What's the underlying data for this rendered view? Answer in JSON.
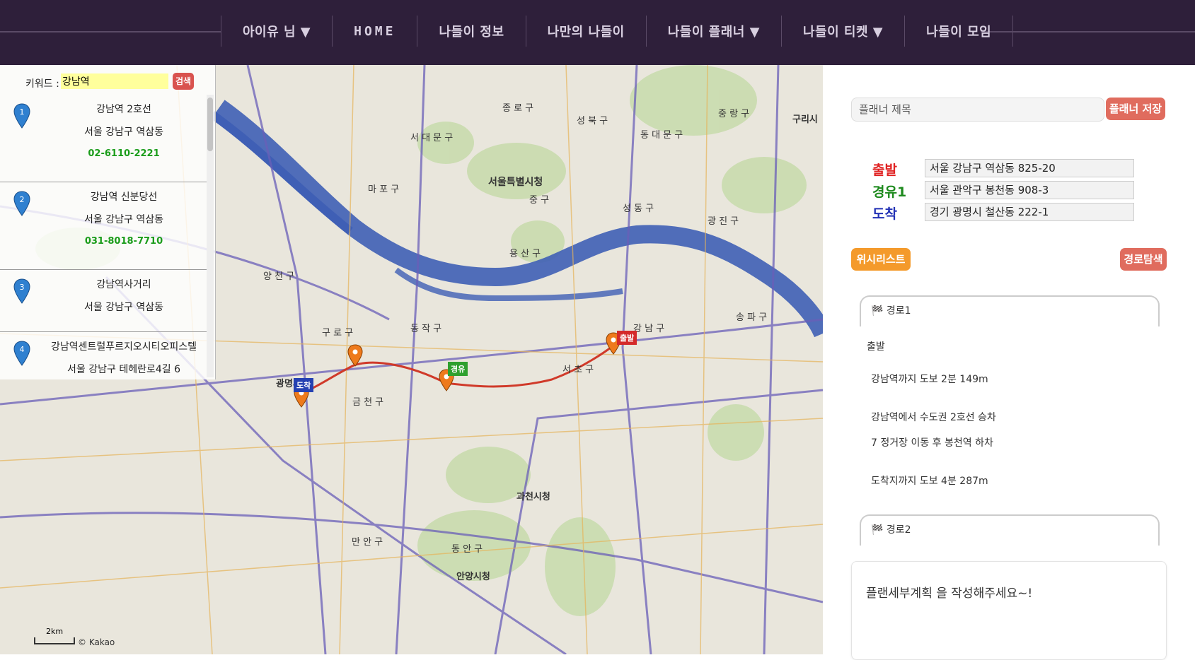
{
  "nav": {
    "user": "아이유 님 ▼",
    "home": "HOME",
    "info": "나들이 정보",
    "mine": "나만의 나들이",
    "planner": "나들이 플래너 ▼",
    "ticket": "나들이 티켓 ▼",
    "meet": "나들이 모임"
  },
  "search": {
    "keyword_label": "키워드 :",
    "keyword_value": "강남역",
    "button": "검색",
    "results": [
      {
        "num": "1",
        "name": "강남역 2호선",
        "address": "서울 강남구 역삼동",
        "phone": "02-6110-2221"
      },
      {
        "num": "2",
        "name": "강남역 신분당선",
        "address": "서울 강남구 역삼동",
        "phone": "031-8018-7710"
      },
      {
        "num": "3",
        "name": "강남역사거리",
        "address": "서울 강남구 역삼동",
        "phone": ""
      },
      {
        "num": "4",
        "name": "강남역센트럴푸르지오시티오피스텔",
        "address": "서울 강남구 테헤란로4길 6",
        "phone": ""
      }
    ]
  },
  "map": {
    "labels": {
      "seoul_hall": "서울특별시청",
      "gwangmyeong": "광명시청",
      "gwacheon": "과천시청",
      "anyang": "안양시청",
      "gangnam": "강 남 구",
      "mapo": "마 포 구",
      "yangcheon": "양 천 구",
      "guro": "구 로 구",
      "dongjak": "동 작 구",
      "geumcheon": "금 천 구",
      "yongsan": "용 산 구",
      "seocho": "서 초 구",
      "songpa": "송 파 구",
      "jongno": "종 로 구",
      "jung": "중 구",
      "seongbuk": "성 북 구",
      "dongdaemun": "동 대 문 구",
      "seodaemun": "서 대 문 구",
      "seongdong": "성 동 구",
      "gwangjin": "광 진 구",
      "manan": "만 안 구",
      "dongan": "동 안 구",
      "guri": "구리시",
      "jungnang": "중 랑 구"
    },
    "flag_start": "출발",
    "flag_via": "경유",
    "flag_end": "도착",
    "scale": "2km",
    "copyright": "© Kakao",
    "colors": {
      "route": "#d03a2a",
      "river": "#3f5fb5",
      "road": "#6a5fb8"
    }
  },
  "panel": {
    "title_placeholder": "플래너 제목",
    "save": "플래너 저장",
    "start_label": "출발",
    "start_value": "서울 강남구 역삼동 825-20",
    "via_label": "경유1",
    "via_value": "서울 관악구 봉천동 908-3",
    "end_label": "도착",
    "end_value": "경기 광명시 철산동 222-1",
    "wishlist": "위시리스트",
    "search_route": "경로탐색",
    "route1": "🏁 경로1",
    "steps": [
      "출발",
      "강남역까지 도보 2분 149m",
      "강남역에서 수도권 2호선 승차",
      "7 정거장 이동 후 봉천역 하차",
      "도착지까지 도보 4분 287m"
    ],
    "route2": "🏁 경로2",
    "plan_placeholder": "플랜세부계획 을 작성해주세요~!"
  }
}
